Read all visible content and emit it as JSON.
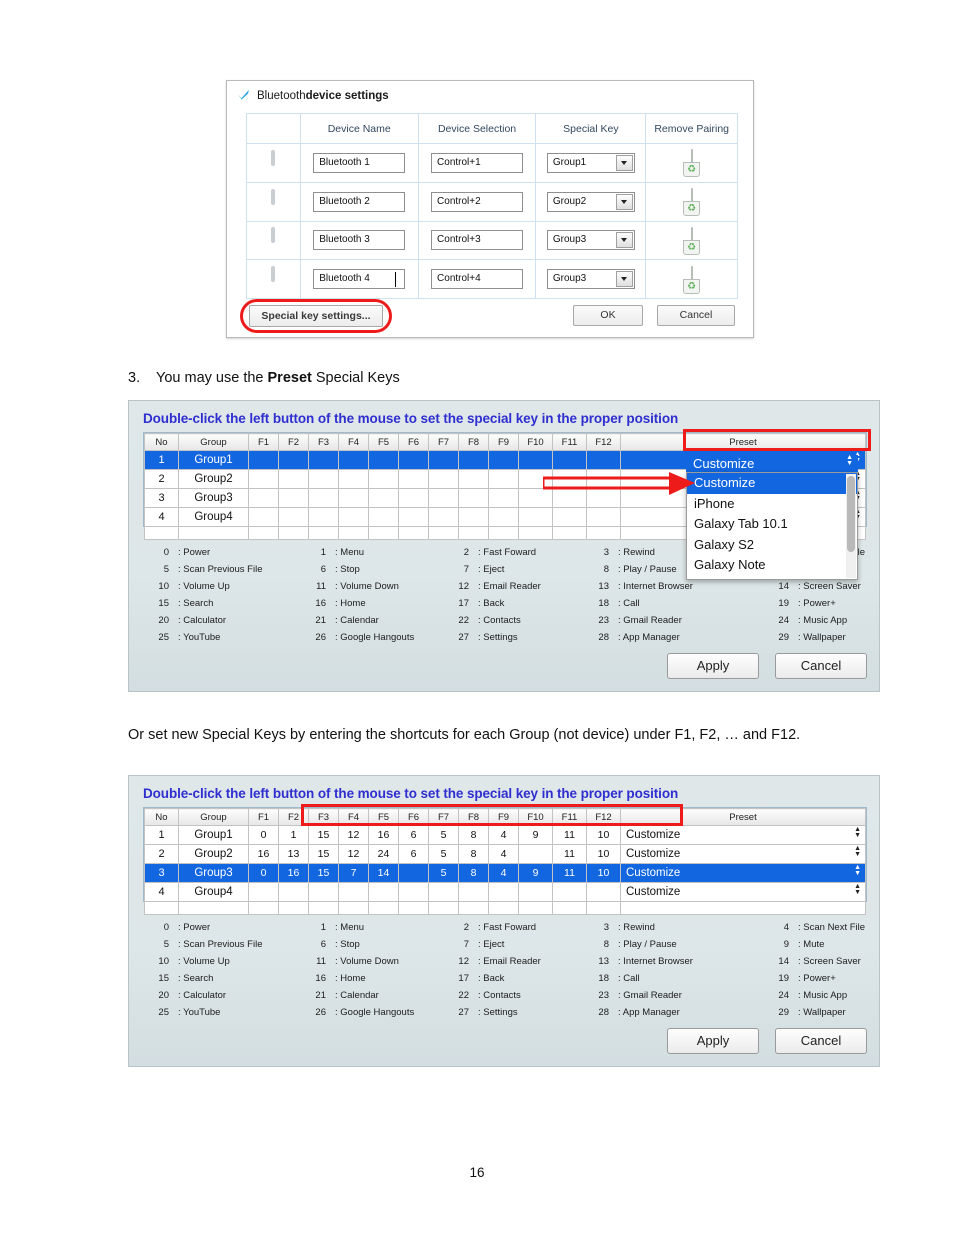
{
  "bluetooth_dialog": {
    "title_regular": "Bluetooth ",
    "title_bold": "device settings",
    "check_icon": "blue-check-icon",
    "columns": [
      "",
      "Device Name",
      "Device Selection",
      "Special Key",
      "Remove Pairing"
    ],
    "rows": [
      {
        "icon": "monitor-icon",
        "device_name": "Bluetooth 1",
        "device_selection": "Control+1",
        "special_key": "Group1",
        "remove": "trash-icon"
      },
      {
        "icon": "monitor-icon",
        "device_name": "Bluetooth 2",
        "device_selection": "Control+2",
        "special_key": "Group2",
        "remove": "trash-icon"
      },
      {
        "icon": "monitor-icon",
        "device_name": "Bluetooth 3",
        "device_selection": "Control+3",
        "special_key": "Group3",
        "remove": "trash-icon"
      },
      {
        "icon": "monitor-icon",
        "device_name": "Bluetooth 4",
        "device_selection": "Control+4",
        "special_key": "Group3",
        "remove": "trash-icon"
      }
    ],
    "special_key_settings_button": "Special key settings...",
    "ok_button": "OK",
    "cancel_button": "Cancel"
  },
  "para_step3": {
    "number": "3.",
    "text_before": "You may use the ",
    "text_bold": "Preset",
    "text_after": " Special Keys"
  },
  "para_or": "Or set new Special Keys by entering the shortcuts for each Group (not device) under F1, F2, … and F12.",
  "skwin_a": {
    "heading": "Double-click the left button of the mouse to set the special key in the proper position",
    "columns": [
      "No",
      "Group",
      "F1",
      "F2",
      "F3",
      "F4",
      "F5",
      "F6",
      "F7",
      "F8",
      "F9",
      "F10",
      "F11",
      "F12",
      "Preset"
    ],
    "rows": [
      {
        "no": "1",
        "group": "Group1",
        "keys": [
          "",
          "",
          "",
          "",
          "",
          "",
          "",
          "",
          "",
          "",
          "",
          ""
        ],
        "preset": "",
        "selected": true
      },
      {
        "no": "2",
        "group": "Group2",
        "keys": [
          "",
          "",
          "",
          "",
          "",
          "",
          "",
          "",
          "",
          "",
          "",
          ""
        ],
        "preset": "",
        "selected": false
      },
      {
        "no": "3",
        "group": "Group3",
        "keys": [
          "",
          "",
          "",
          "",
          "",
          "",
          "",
          "",
          "",
          "",
          "",
          ""
        ],
        "preset": "",
        "selected": false
      },
      {
        "no": "4",
        "group": "Group4",
        "keys": [
          "",
          "",
          "",
          "",
          "",
          "",
          "",
          "",
          "",
          "",
          "",
          ""
        ],
        "preset": "",
        "selected": false
      }
    ],
    "dropdown": {
      "current_value": "Customize",
      "options": [
        "Customize",
        "iPhone",
        "Galaxy Tab 10.1",
        "Galaxy S2",
        "Galaxy Note"
      ],
      "selected_option": "Customize"
    },
    "apply_button": "Apply",
    "cancel_button": "Cancel"
  },
  "skwin_b": {
    "heading": "Double-click the left button of the mouse to set the special key in the proper position",
    "columns": [
      "No",
      "Group",
      "F1",
      "F2",
      "F3",
      "F4",
      "F5",
      "F6",
      "F7",
      "F8",
      "F9",
      "F10",
      "F11",
      "F12",
      "Preset"
    ],
    "rows": [
      {
        "no": "1",
        "group": "Group1",
        "keys": [
          "0",
          "1",
          "15",
          "12",
          "16",
          "6",
          "5",
          "8",
          "4",
          "9",
          "11",
          "10"
        ],
        "preset": "Customize",
        "selected": false
      },
      {
        "no": "2",
        "group": "Group2",
        "keys": [
          "16",
          "13",
          "15",
          "12",
          "24",
          "6",
          "5",
          "8",
          "4",
          "",
          "11",
          "10"
        ],
        "preset": "Customize",
        "selected": false
      },
      {
        "no": "3",
        "group": "Group3",
        "keys": [
          "0",
          "16",
          "15",
          "7",
          "14",
          "",
          "5",
          "8",
          "4",
          "9",
          "11",
          "10"
        ],
        "preset": "Customize",
        "selected": true
      },
      {
        "no": "4",
        "group": "Group4",
        "keys": [
          "",
          "",
          "",
          "",
          "",
          "",
          "",
          "",
          "",
          "",
          "",
          ""
        ],
        "preset": "Customize",
        "selected": false
      }
    ],
    "apply_button": "Apply",
    "cancel_button": "Cancel"
  },
  "key_legend": [
    {
      "index": "0",
      "label": ": Power"
    },
    {
      "index": "1",
      "label": ": Menu"
    },
    {
      "index": "2",
      "label": ": Fast Foward"
    },
    {
      "index": "3",
      "label": ": Rewind"
    },
    {
      "index": "4",
      "label": ": Scan Next File"
    },
    {
      "index": "5",
      "label": ": Scan Previous File"
    },
    {
      "index": "6",
      "label": ": Stop"
    },
    {
      "index": "7",
      "label": ": Eject"
    },
    {
      "index": "8",
      "label": ": Play / Pause"
    },
    {
      "index": "9",
      "label": ": Mute"
    },
    {
      "index": "10",
      "label": ": Volume Up"
    },
    {
      "index": "11",
      "label": ": Volume Down"
    },
    {
      "index": "12",
      "label": ": Email Reader"
    },
    {
      "index": "13",
      "label": ": Internet Browser"
    },
    {
      "index": "14",
      "label": ": Screen Saver"
    },
    {
      "index": "15",
      "label": ": Search"
    },
    {
      "index": "16",
      "label": ": Home"
    },
    {
      "index": "17",
      "label": ": Back"
    },
    {
      "index": "18",
      "label": ": Call"
    },
    {
      "index": "19",
      "label": ": Power+"
    },
    {
      "index": "20",
      "label": ": Calculator"
    },
    {
      "index": "21",
      "label": ": Calendar"
    },
    {
      "index": "22",
      "label": ": Contacts"
    },
    {
      "index": "23",
      "label": ": Gmail Reader"
    },
    {
      "index": "24",
      "label": ": Music App"
    },
    {
      "index": "25",
      "label": ": YouTube"
    },
    {
      "index": "26",
      "label": ": Google Hangouts"
    },
    {
      "index": "27",
      "label": ": Settings"
    },
    {
      "index": "28",
      "label": ": App Manager"
    },
    {
      "index": "29",
      "label": ": Wallpaper"
    }
  ],
  "page_number": "16",
  "colors": {
    "selection_blue": "#1266e0",
    "annotation_red": "#ee1b1b",
    "heading_blue": "#2f2fd0",
    "window_bg": "#dfe7e9"
  }
}
